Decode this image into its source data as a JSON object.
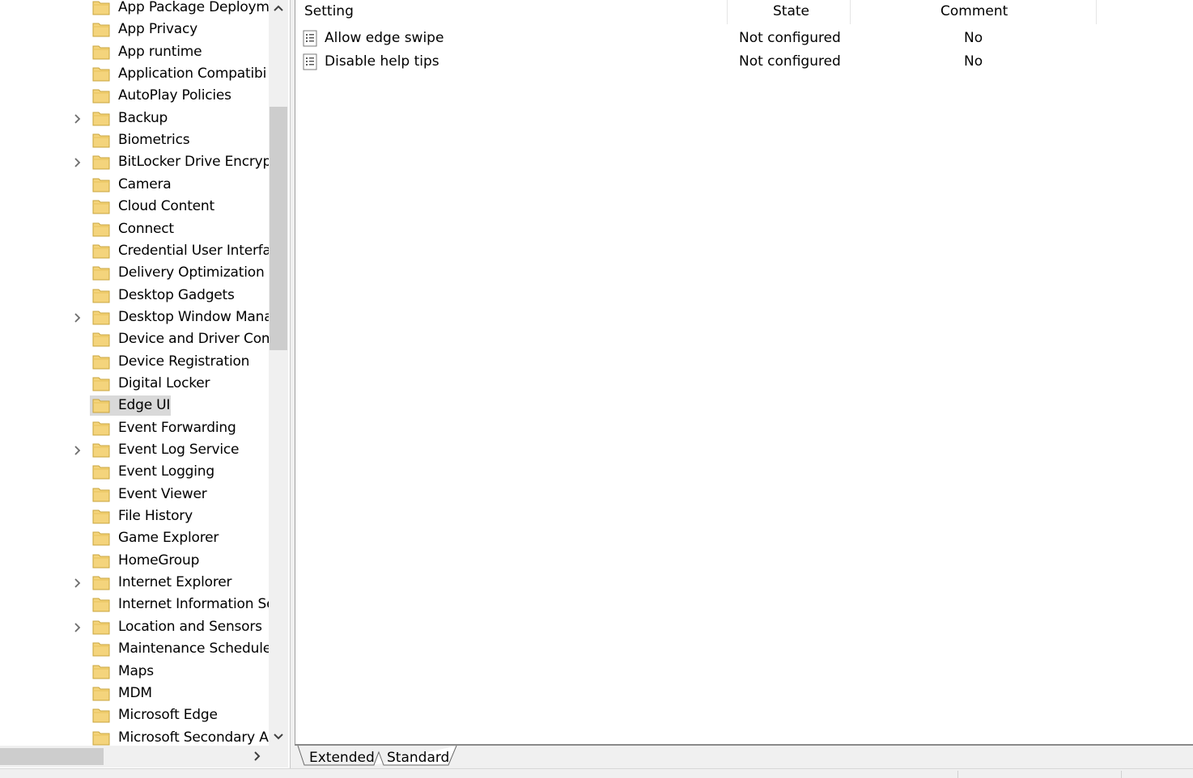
{
  "tree": {
    "items": [
      {
        "label": "App Package Deploym",
        "expandable": false
      },
      {
        "label": "App Privacy",
        "expandable": false
      },
      {
        "label": "App runtime",
        "expandable": false
      },
      {
        "label": "Application Compatibi",
        "expandable": false
      },
      {
        "label": "AutoPlay Policies",
        "expandable": false
      },
      {
        "label": "Backup",
        "expandable": true
      },
      {
        "label": "Biometrics",
        "expandable": false
      },
      {
        "label": "BitLocker Drive Encrypt",
        "expandable": true
      },
      {
        "label": "Camera",
        "expandable": false
      },
      {
        "label": "Cloud Content",
        "expandable": false
      },
      {
        "label": "Connect",
        "expandable": false
      },
      {
        "label": "Credential User Interfac",
        "expandable": false
      },
      {
        "label": "Delivery Optimization",
        "expandable": false
      },
      {
        "label": "Desktop Gadgets",
        "expandable": false
      },
      {
        "label": "Desktop Window Mana",
        "expandable": true
      },
      {
        "label": "Device and Driver Com",
        "expandable": false
      },
      {
        "label": "Device Registration",
        "expandable": false
      },
      {
        "label": "Digital Locker",
        "expandable": false
      },
      {
        "label": "Edge UI",
        "expandable": false,
        "selected": true
      },
      {
        "label": "Event Forwarding",
        "expandable": false
      },
      {
        "label": "Event Log Service",
        "expandable": true
      },
      {
        "label": "Event Logging",
        "expandable": false
      },
      {
        "label": "Event Viewer",
        "expandable": false
      },
      {
        "label": "File History",
        "expandable": false
      },
      {
        "label": "Game Explorer",
        "expandable": false
      },
      {
        "label": "HomeGroup",
        "expandable": false
      },
      {
        "label": "Internet Explorer",
        "expandable": true
      },
      {
        "label": "Internet Information Se",
        "expandable": false
      },
      {
        "label": "Location and Sensors",
        "expandable": true
      },
      {
        "label": "Maintenance Schedule",
        "expandable": false
      },
      {
        "label": "Maps",
        "expandable": false
      },
      {
        "label": "MDM",
        "expandable": false
      },
      {
        "label": "Microsoft Edge",
        "expandable": false
      },
      {
        "label": "Microsoft Secondary A",
        "expandable": false
      }
    ]
  },
  "table": {
    "columns": {
      "setting": "Setting",
      "state": "State",
      "comment": "Comment"
    },
    "rows": [
      {
        "setting": "Allow edge swipe",
        "state": "Not configured",
        "comment": "No"
      },
      {
        "setting": "Disable help tips",
        "state": "Not configured",
        "comment": "No"
      }
    ]
  },
  "tabs": {
    "extended": "Extended",
    "standard": "Standard",
    "active": "standard"
  },
  "colors": {
    "folder": "#f4d47c",
    "selection": "#d9d9d9",
    "scroll_thumb": "#cdcdcd"
  }
}
